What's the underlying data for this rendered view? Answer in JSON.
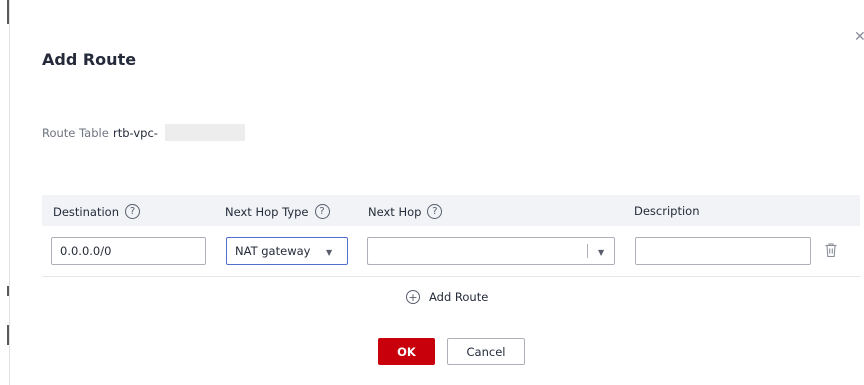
{
  "dialog": {
    "title": "Add Route",
    "close_icon": "close-icon",
    "route_table": {
      "label": "Route Table",
      "value": "rtb-vpc-"
    }
  },
  "table": {
    "columns": [
      {
        "label": "Destination",
        "help_icon": "help-circle-icon"
      },
      {
        "label": "Next Hop Type",
        "help_icon": "help-circle-icon"
      },
      {
        "label": "Next Hop",
        "help_icon": "help-circle-icon"
      },
      {
        "label": "Description"
      }
    ],
    "row": {
      "destination": "0.0.0.0/0",
      "next_hop_type": "NAT gateway",
      "next_hop": "",
      "description": "",
      "delete_icon": "trash-icon"
    }
  },
  "actions": {
    "add_route": "Add Route",
    "ok": "OK",
    "cancel": "Cancel"
  },
  "colors": {
    "primary": "#c7000b",
    "focus_border": "#526ecc",
    "header_bg": "#f1f3f6"
  }
}
